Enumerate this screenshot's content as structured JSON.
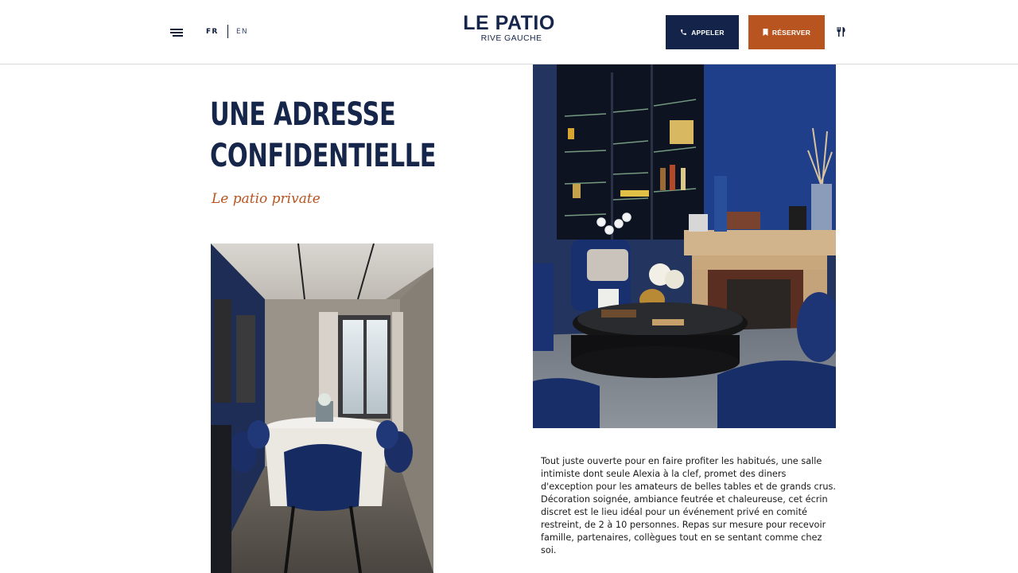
{
  "header": {
    "lang_fr": "FR",
    "lang_en": "EN",
    "logo_main": "LE PATIO",
    "logo_sub": "RIVE GAUCHE",
    "call_label": "APPELER",
    "book_label": "RÉSERVER",
    "icons": [
      "menu-icon",
      "phone-icon",
      "bookmark-icon",
      "utensils-icon"
    ]
  },
  "main": {
    "title_line1": "UNE ADRESSE",
    "title_line2": "CONFIDENTIELLE",
    "subtitle": "Le patio private",
    "paragraph1": "Tout juste ouverte pour en faire profiter les habitués, une salle intimiste dont seule Alexia à la clef, promet des diners d'exception pour les amateurs de belles tables et de grands crus.",
    "paragraph2": "Décoration soignée, ambiance feutrée et chaleureuse, cet écrin discret est le lieu idéal pour un événement privé en comité restreint, de 2 à 10 personnes. Repas sur mesure pour recevoir famille, partenaires, collègues tout en se sentant comme chez soi."
  },
  "colors": {
    "navy": "#13234a",
    "accent": "#b8541f",
    "text": "#1a1a1a",
    "divider": "#d9d9d9"
  }
}
